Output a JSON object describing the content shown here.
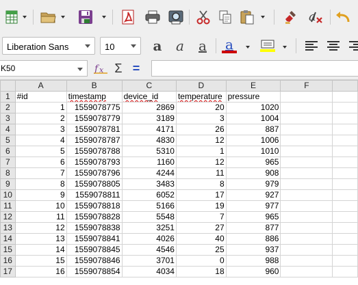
{
  "toolbar": {
    "icons": [
      "spreadsheet-new-icon",
      "open-folder-icon",
      "save-icon",
      "export-pdf-icon",
      "print-icon",
      "print-preview-icon",
      "cut-icon",
      "copy-icon",
      "paste-icon",
      "clone-formatting-icon",
      "clear-formatting-icon",
      "undo-icon"
    ]
  },
  "format_bar": {
    "font_name": "Liberation Sans",
    "font_size": "10",
    "font_color": "#cc0000",
    "highlight_color": "#ffff00"
  },
  "formula_bar": {
    "name_box": "K50",
    "formula": ""
  },
  "sheet": {
    "columns": [
      "A",
      "B",
      "C",
      "D",
      "E",
      "F"
    ],
    "rows": [
      {
        "n": "1",
        "a": "#id",
        "b": "timestamp",
        "c": "device_id",
        "d": "temperature",
        "e": "pressure"
      },
      {
        "n": "2",
        "a": "1",
        "b": "1559078775",
        "c": "2869",
        "d": "20",
        "e": "1020"
      },
      {
        "n": "3",
        "a": "2",
        "b": "1559078779",
        "c": "3189",
        "d": "3",
        "e": "1004"
      },
      {
        "n": "4",
        "a": "3",
        "b": "1559078781",
        "c": "4171",
        "d": "26",
        "e": "887"
      },
      {
        "n": "5",
        "a": "4",
        "b": "1559078787",
        "c": "4830",
        "d": "12",
        "e": "1006"
      },
      {
        "n": "6",
        "a": "5",
        "b": "1559078788",
        "c": "5310",
        "d": "1",
        "e": "1010"
      },
      {
        "n": "7",
        "a": "6",
        "b": "1559078793",
        "c": "1160",
        "d": "12",
        "e": "965"
      },
      {
        "n": "8",
        "a": "7",
        "b": "1559078796",
        "c": "4244",
        "d": "11",
        "e": "908"
      },
      {
        "n": "9",
        "a": "8",
        "b": "1559078805",
        "c": "3483",
        "d": "8",
        "e": "979"
      },
      {
        "n": "10",
        "a": "9",
        "b": "1559078811",
        "c": "6052",
        "d": "17",
        "e": "927"
      },
      {
        "n": "11",
        "a": "10",
        "b": "1559078818",
        "c": "5166",
        "d": "19",
        "e": "977"
      },
      {
        "n": "12",
        "a": "11",
        "b": "1559078828",
        "c": "5548",
        "d": "7",
        "e": "965"
      },
      {
        "n": "13",
        "a": "12",
        "b": "1559078838",
        "c": "3251",
        "d": "27",
        "e": "877"
      },
      {
        "n": "14",
        "a": "13",
        "b": "1559078841",
        "c": "4026",
        "d": "40",
        "e": "886"
      },
      {
        "n": "15",
        "a": "14",
        "b": "1559078845",
        "c": "4546",
        "d": "25",
        "e": "937"
      },
      {
        "n": "16",
        "a": "15",
        "b": "1559078846",
        "c": "3701",
        "d": "0",
        "e": "988"
      },
      {
        "n": "17",
        "a": "16",
        "b": "1559078854",
        "c": "4034",
        "d": "18",
        "e": "960"
      }
    ]
  }
}
